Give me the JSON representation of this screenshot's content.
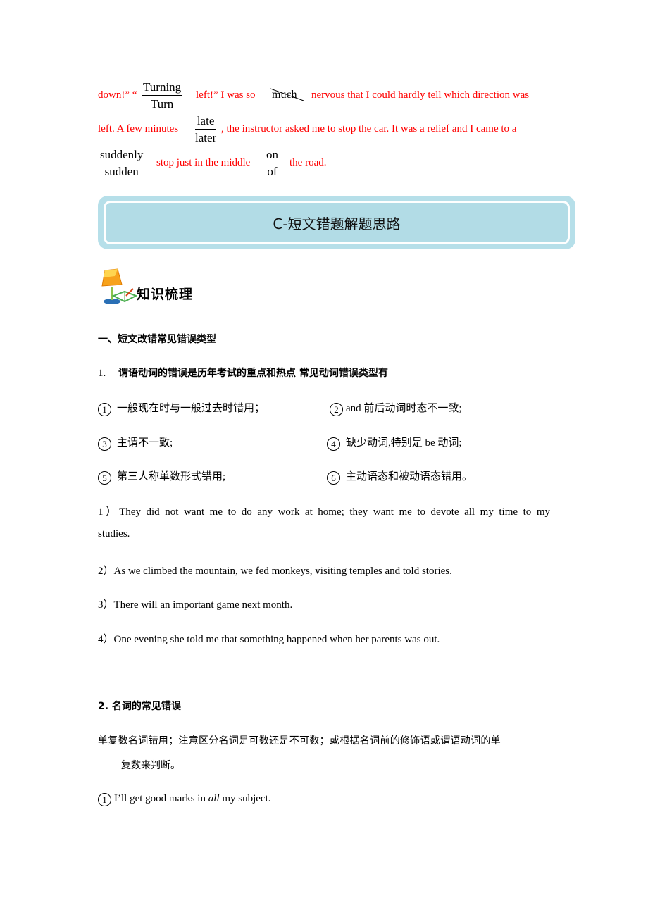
{
  "passage": {
    "line1": {
      "part1": "down!” “",
      "part2": "left!” I was so",
      "part3": "nervous that I could hardly tell which direction was"
    },
    "line2": {
      "part1": "left. A few minutes",
      "part2": ", the instructor asked me to stop the car. It was a relief and I came to a"
    },
    "line3": {
      "part1": "stop just in the middle",
      "part2": "the road."
    },
    "corrections": [
      {
        "correct": "Turning",
        "wrong": "Turn"
      },
      {
        "deleted": "much"
      },
      {
        "correct": "late",
        "wrong": "later"
      },
      {
        "correct": "suddenly",
        "wrong": "sudden"
      },
      {
        "correct": "on",
        "wrong": "of"
      }
    ],
    "text_color": "#ff0000"
  },
  "banner": {
    "title": "C-短文错题解题思路",
    "bg_color": "#b6dfe9"
  },
  "knowledge": {
    "title": "知识梳理",
    "icon": "lamp-book-icon"
  },
  "section1": {
    "heading": "一、短文改错常见错误类型",
    "sub1": {
      "number": "1.",
      "title": "谓语动词的错误是历年考试的重点和热点  常见动词错误类型有"
    },
    "types": [
      {
        "num": "1",
        "text": "一般现在时与一般过去时错用；"
      },
      {
        "num": "2",
        "text": "and  前后动词时态不一致;"
      },
      {
        "num": "3",
        "text": "主谓不一致;"
      },
      {
        "num": "4",
        "text": "缺少动词,特别是 be 动词;"
      },
      {
        "num": "5",
        "text": "第三人称单数形式错用;"
      },
      {
        "num": "6",
        "text": "主动语态和被动语态错用。"
      }
    ],
    "examples": [
      {
        "label": "1）",
        "text": "They did not want me to do any work at home; they want me to devote all my time to my",
        "cont": "studies."
      },
      {
        "label": "2）",
        "text": "As we climbed the mountain, we fed monkeys, visiting temples and told stories."
      },
      {
        "label": "3）",
        "text": "There will an important game next month."
      },
      {
        "label": "4）",
        "text": "One evening she told me that something happened when her parents was out."
      }
    ]
  },
  "section2": {
    "heading": "2.  名词的常见错误",
    "desc_line1": "单复数名词错用；注意区分名词是可数还是不可数；或根据名词前的修饰语或谓语动词的单",
    "desc_line2": "复数来判断。",
    "example": {
      "num": "1",
      "before": "I’ll get good marks in ",
      "italic": "all",
      "after": " my subject."
    }
  }
}
